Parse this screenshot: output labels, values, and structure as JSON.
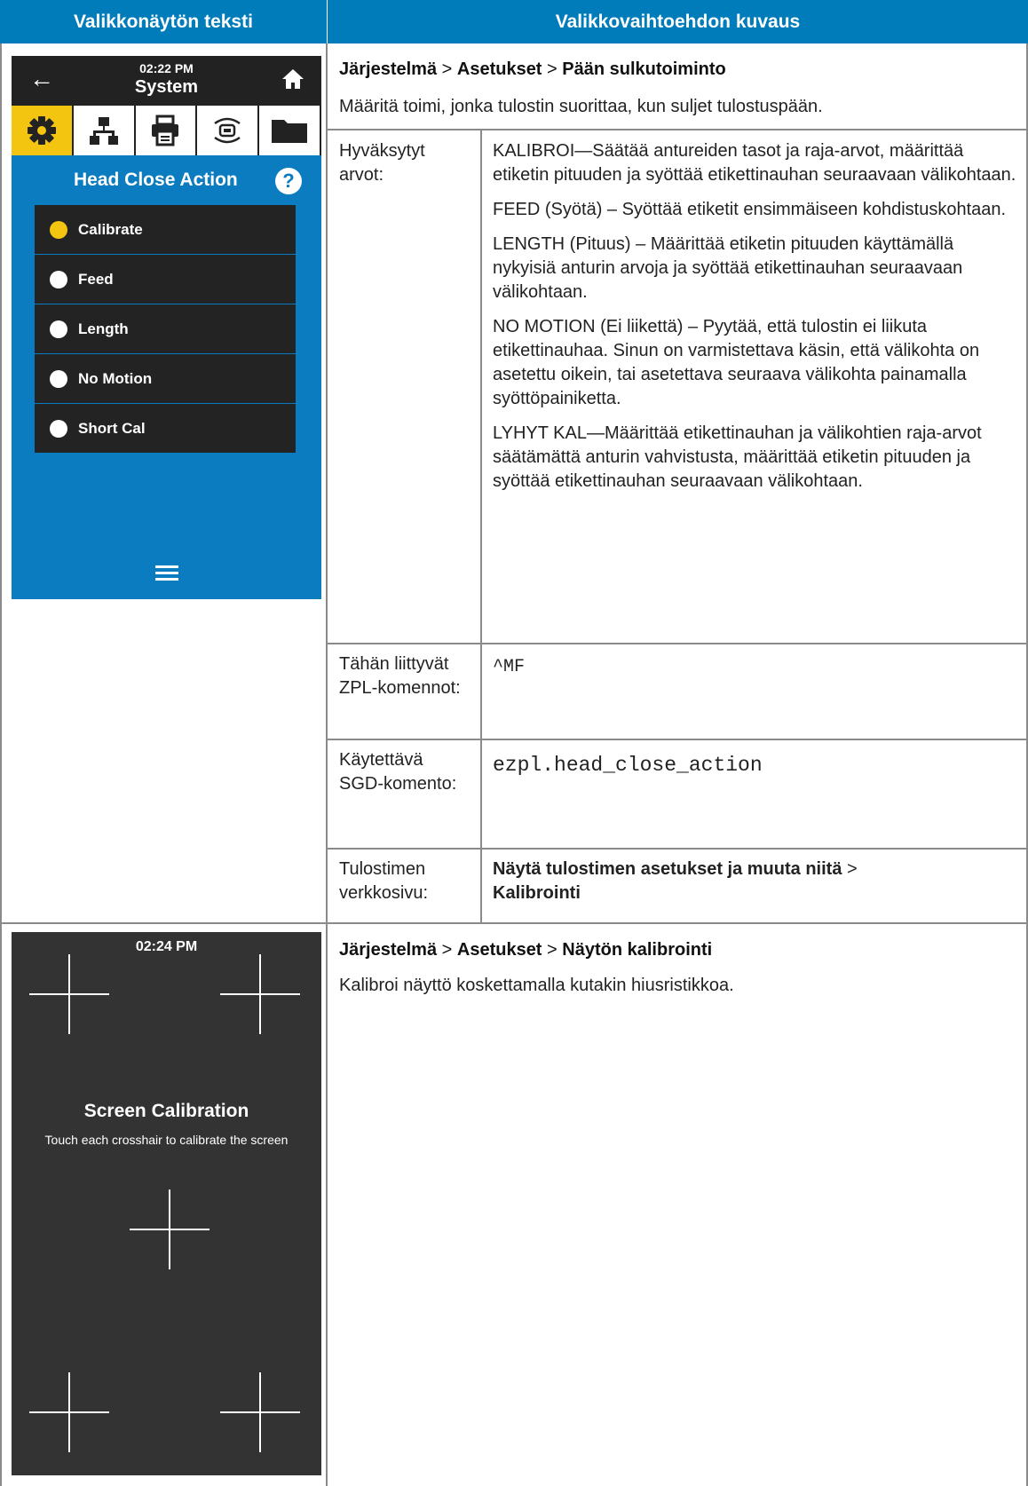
{
  "header": {
    "left": "Valikkonäytön teksti",
    "right": "Valikkovaihtoehdon kuvaus"
  },
  "section1": {
    "path": {
      "p1": "Järjestelmä",
      "sep1": " > ",
      "p2": "Asetukset",
      "sep2": " > ",
      "p3": "Pään sulkutoiminto"
    },
    "description": "Määritä toimi, jonka tulostin suorittaa, kun suljet tulostuspään.",
    "rows": {
      "accepted_label": "Hyväksytyt arvot:",
      "accepted_values": [
        "KALIBROI—Säätää antureiden tasot ja raja-arvot, määrittää etiketin pituuden ja syöttää etikettinauhan seuraavaan välikohtaan.",
        "FEED (Syötä) – Syöttää etiketit ensimmäiseen kohdistuskohtaan.",
        "LENGTH (Pituus) – Määrittää etiketin pituuden käyttämällä nykyisiä anturin arvoja ja syöttää etikettinauhan seuraavaan välikohtaan.",
        "NO MOTION (Ei liikettä) – Pyytää, että tulostin ei liikuta etikettinauhaa. Sinun on varmistettava käsin, että välikohta on asetettu oikein, tai asetettava seuraava välikohta painamalla syöttöpainiketta.",
        "LYHYT KAL—Määrittää etikettinauhan ja välikohtien raja-arvot säätämättä anturin vahvistusta, määrittää etiketin pituuden ja syöttää etikettinauhan seuraavaan välikohtaan."
      ],
      "zpl_label": "Tähän liittyvät ZPL-komennot:",
      "zpl_value": "^MF",
      "sgd_label": "Käytettävä SGD-komento:",
      "sgd_value": "ezpl.head_close_action",
      "web_label": "Tulostimen verkkosivu:",
      "web_p1": "Näytä tulostimen asetukset ja muuta niitä",
      "web_sep": " > ",
      "web_p2": "Kalibrointi"
    }
  },
  "screen1": {
    "time": "02:22 PM",
    "title": "System",
    "back_icon": "left-arrow-icon",
    "home_icon": "home-icon",
    "tabs": [
      "gear-icon",
      "network-icon",
      "printer-icon",
      "wireless-icon",
      "folder-icon"
    ],
    "screen_title": "Head Close Action",
    "help_glyph": "?",
    "options": [
      "Calibrate",
      "Feed",
      "Length",
      "No Motion",
      "Short Cal"
    ],
    "selected_index": 0,
    "accent_color": "#f3c410",
    "background_color": "#0c7cc1"
  },
  "section2": {
    "path": {
      "p1": "Järjestelmä",
      "sep1": " > ",
      "p2": "Asetukset",
      "sep2": " > ",
      "p3": "Näytön kalibrointi"
    },
    "description": "Kalibroi näyttö koskettamalla kutakin hiusristikkoa."
  },
  "screen2": {
    "time": "02:24 PM",
    "title": "Screen Calibration",
    "subtitle": "Touch each crosshair to calibrate the screen"
  }
}
